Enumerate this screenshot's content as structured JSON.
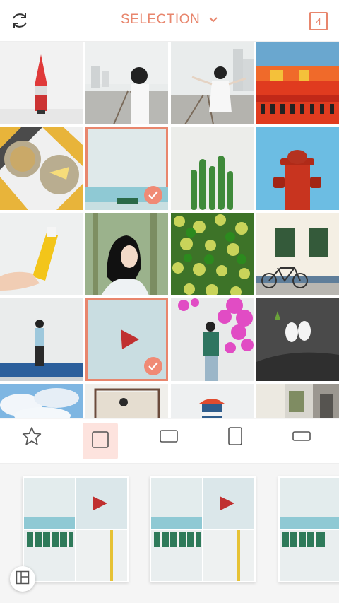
{
  "header": {
    "title": "SELECTION",
    "count": "4",
    "refresh_icon": "refresh-icon",
    "chevron_icon": "chevron-down-icon"
  },
  "grid": {
    "selected_color": "#e8866d",
    "photos": [
      {
        "name": "gnome-figure",
        "selected": false
      },
      {
        "name": "girl-railway-1",
        "selected": false
      },
      {
        "name": "girl-railway-2",
        "selected": false
      },
      {
        "name": "orange-building",
        "selected": false
      },
      {
        "name": "plates-cake",
        "selected": false
      },
      {
        "name": "pale-wall",
        "selected": true
      },
      {
        "name": "cactus",
        "selected": false
      },
      {
        "name": "fire-hydrant",
        "selected": false
      },
      {
        "name": "yellow-drink",
        "selected": false
      },
      {
        "name": "girl-forest",
        "selected": false
      },
      {
        "name": "limes",
        "selected": false
      },
      {
        "name": "bicycle-wall",
        "selected": false
      },
      {
        "name": "girl-blue-wall",
        "selected": false
      },
      {
        "name": "play-sign",
        "selected": true
      },
      {
        "name": "girl-flowers",
        "selected": false
      },
      {
        "name": "white-shoes",
        "selected": false
      }
    ]
  },
  "toolbar": {
    "items": [
      {
        "icon": "star-icon",
        "active": false
      },
      {
        "icon": "square-ratio-icon",
        "active": true
      },
      {
        "icon": "landscape-ratio-icon",
        "active": false
      },
      {
        "icon": "portrait-ratio-icon",
        "active": false
      },
      {
        "icon": "wide-ratio-icon",
        "active": false
      }
    ]
  },
  "strip": {
    "layout_button_icon": "layout-icon"
  }
}
